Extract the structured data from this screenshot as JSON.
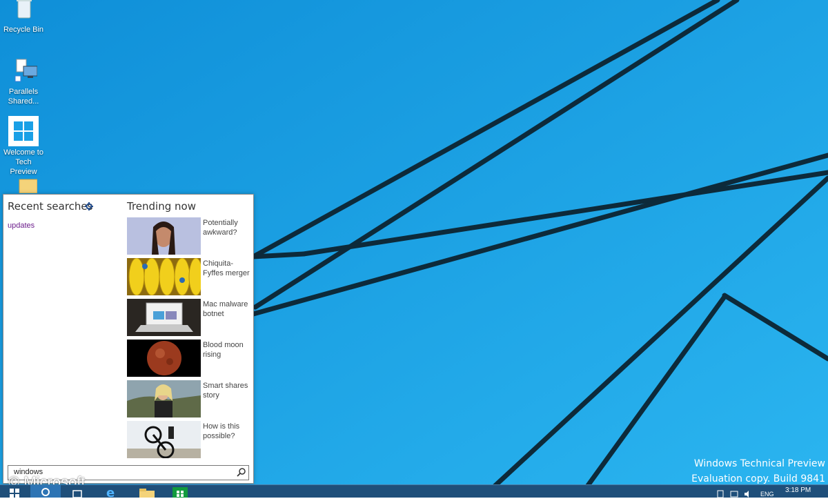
{
  "desktop": {
    "icons": [
      {
        "label": "Recycle Bin",
        "icon": "recycle-bin-icon"
      },
      {
        "label": "Parallels Shared...",
        "icon": "shared-folders-icon"
      },
      {
        "label": "Welcome to Tech Preview",
        "icon": "windows-logo-icon"
      },
      {
        "label": "",
        "icon": "folder-icon"
      }
    ],
    "wallpaper_color": "#1aa0e6"
  },
  "search_panel": {
    "recent_title": "Recent searches",
    "recent_items": [
      "updates"
    ],
    "trending_title": "Trending now",
    "trending": [
      {
        "caption": "Potentially awkward?",
        "image": "woman-portrait-thumbnail"
      },
      {
        "caption": "Chiquita-Fyffes merger",
        "image": "bananas-thumbnail"
      },
      {
        "caption": "Mac malware botnet",
        "image": "laptop-thumbnail"
      },
      {
        "caption": "Blood moon rising",
        "image": "moon-thumbnail"
      },
      {
        "caption": "Smart shares story",
        "image": "woman-outdoors-thumbnail"
      },
      {
        "caption": "How is this possible?",
        "image": "bmx-bike-thumbnail"
      }
    ],
    "query": "windows"
  },
  "watermark": "© Microsoft",
  "build_info": {
    "line1": "Windows Technical Preview",
    "line2": "Evaluation copy. Build 9841"
  },
  "taskbar": {
    "buttons": [
      "start-button",
      "search-button",
      "task-view-button",
      "internet-explorer-button",
      "file-explorer-button",
      "store-button"
    ],
    "tray": {
      "language": "ENG",
      "time": "3:18 PM"
    }
  },
  "colors": {
    "accent": "#1aa0e6",
    "taskbar": "#1f4f7a",
    "recent_link": "#6b1d8b"
  }
}
